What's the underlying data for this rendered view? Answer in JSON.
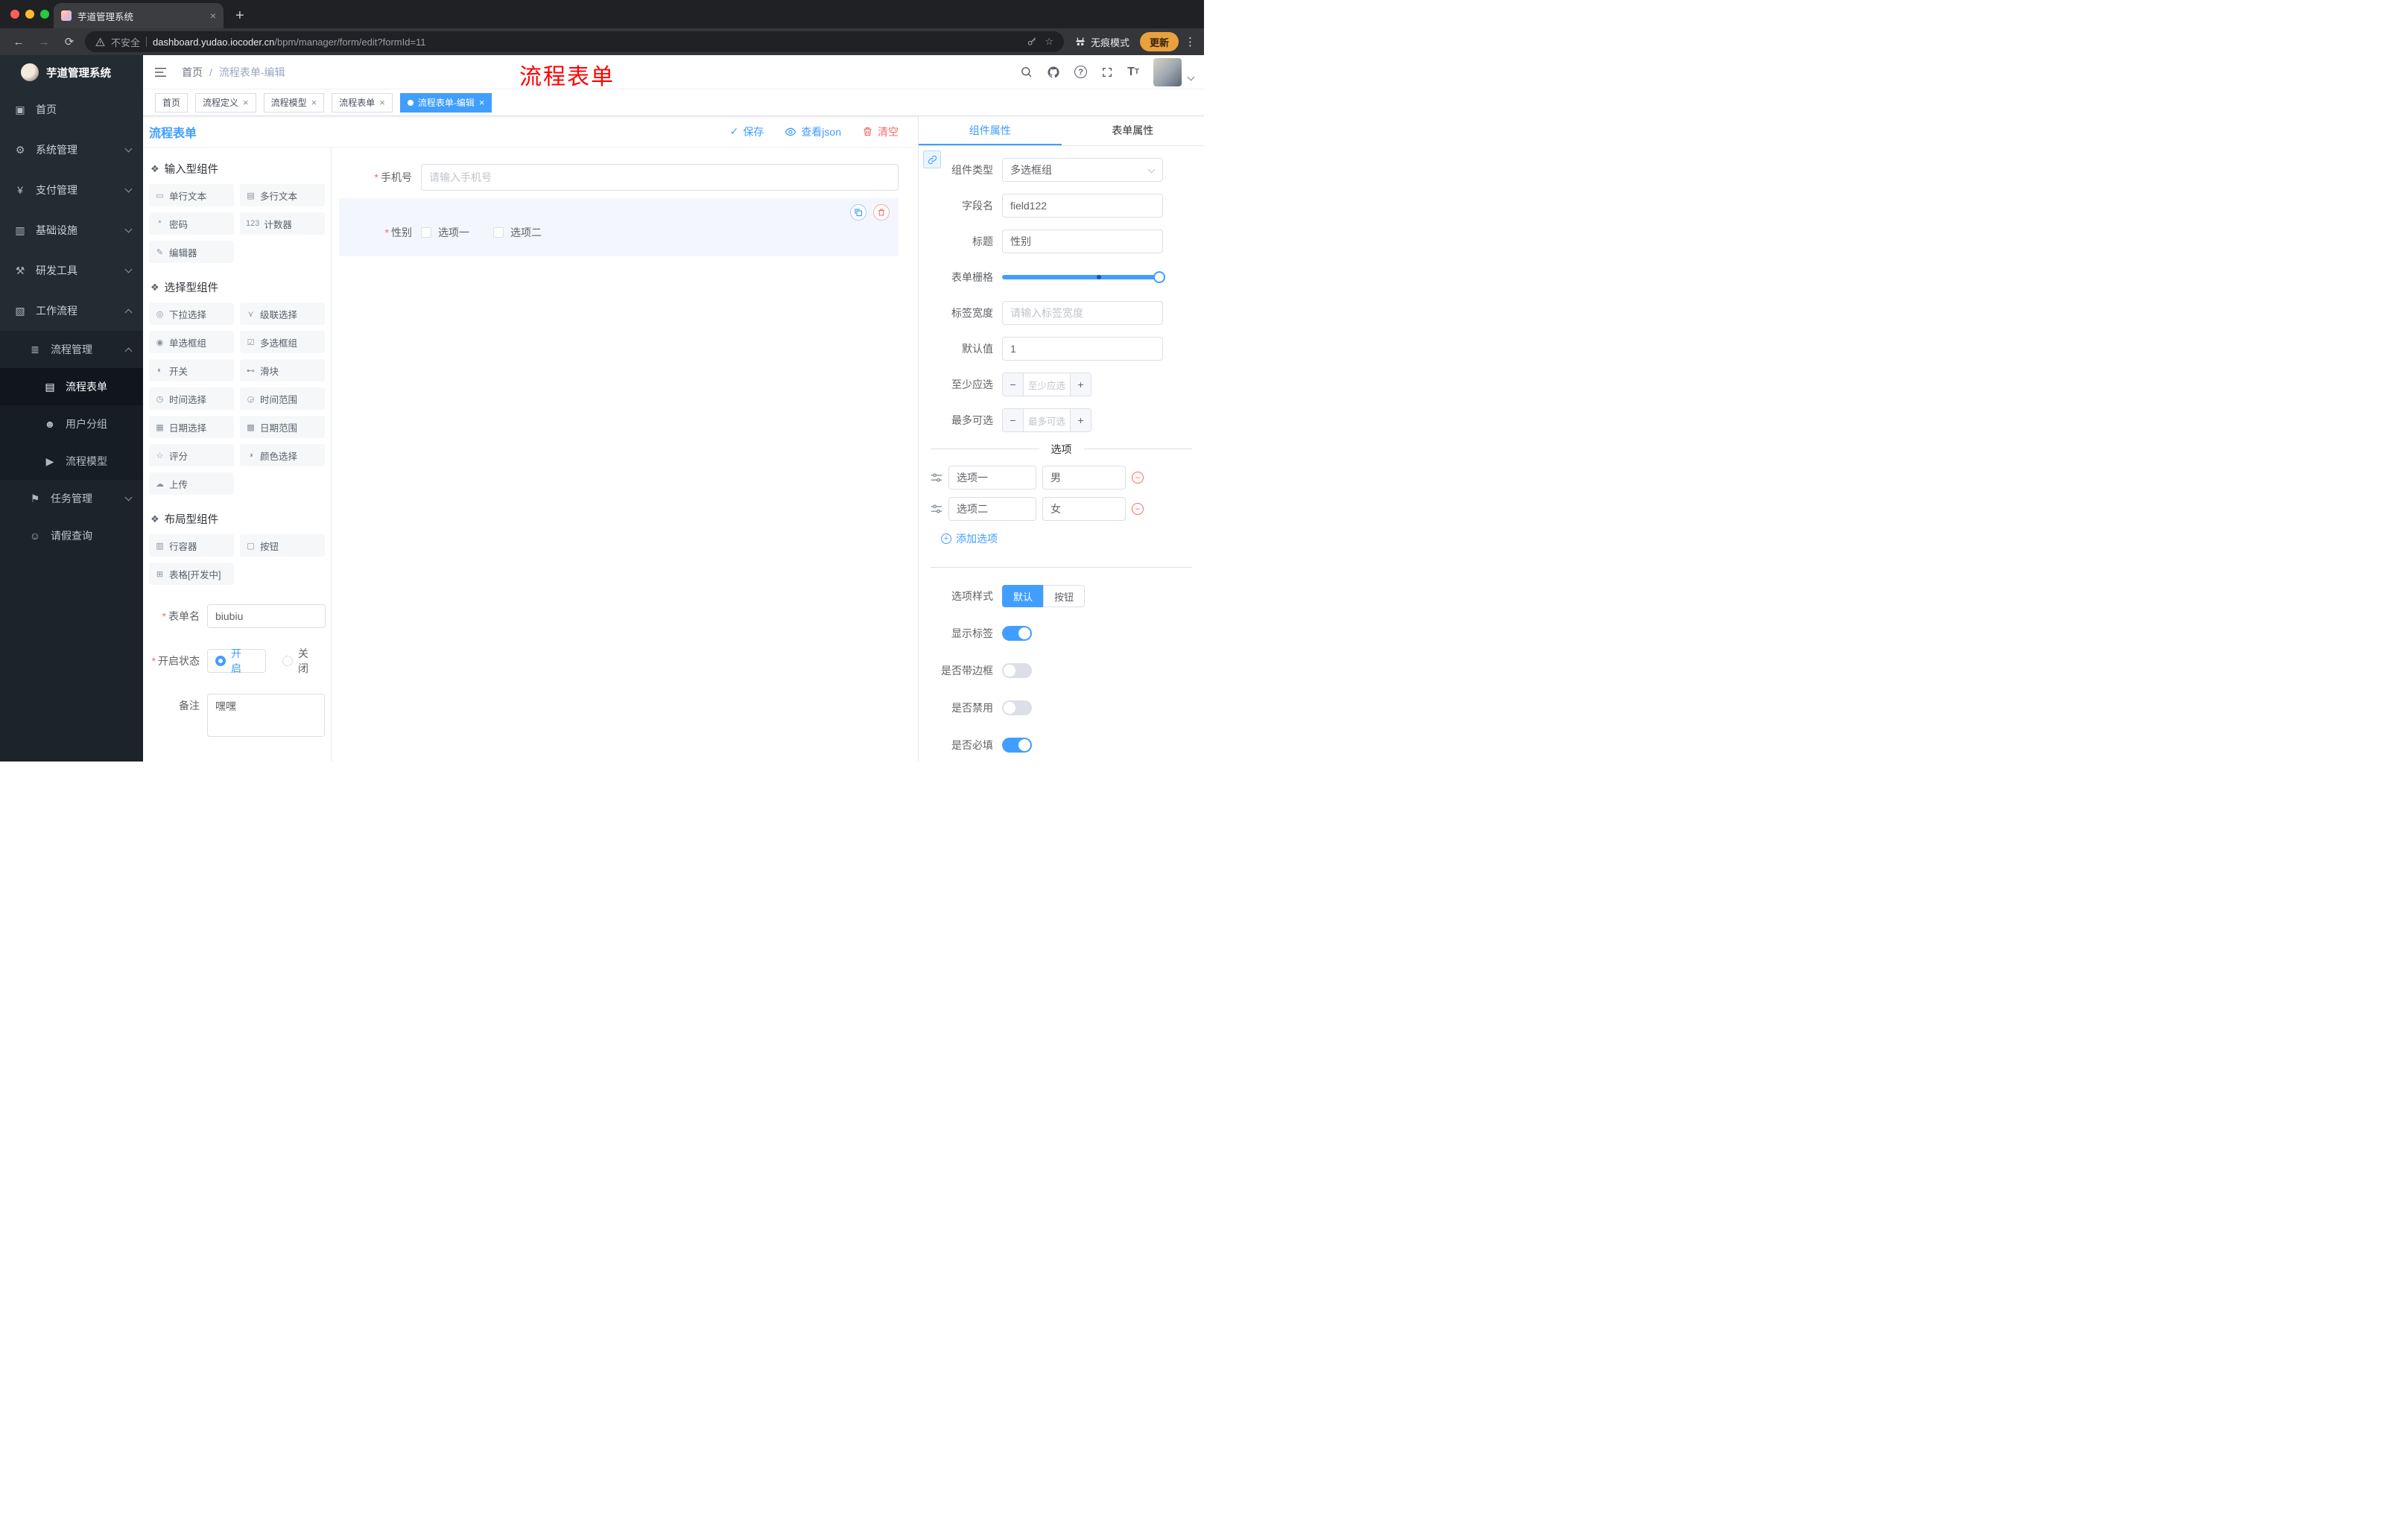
{
  "browser": {
    "tab_title": "芋道管理系统",
    "security_label": "不安全",
    "url_domain": "dashboard.yudao.iocoder.cn",
    "url_path": "/bpm/manager/form/edit?formId=11",
    "incognito_label": "无痕模式",
    "update_label": "更新"
  },
  "sidebar": {
    "logo_title": "芋道管理系统",
    "items": [
      {
        "label": "首页",
        "glyph": "▣"
      },
      {
        "label": "系统管理",
        "glyph": "⚙"
      },
      {
        "label": "支付管理",
        "glyph": "¥"
      },
      {
        "label": "基础设施",
        "glyph": "▥"
      },
      {
        "label": "研发工具",
        "glyph": "⚒"
      },
      {
        "label": "工作流程",
        "glyph": "▧"
      }
    ],
    "sub": [
      {
        "label": "流程管理",
        "glyph": "≣"
      },
      {
        "label": "流程表单",
        "glyph": "▤"
      },
      {
        "label": "用户分组",
        "glyph": "☻"
      },
      {
        "label": "流程模型",
        "glyph": "▶"
      },
      {
        "label": "任务管理",
        "glyph": "⚑"
      },
      {
        "label": "请假查询",
        "glyph": "☺"
      }
    ]
  },
  "header": {
    "breadcrumb_root": "首页",
    "breadcrumb_current": "流程表单-编辑",
    "annotation": "流程表单"
  },
  "tags": [
    {
      "label": "首页"
    },
    {
      "label": "流程定义"
    },
    {
      "label": "流程模型"
    },
    {
      "label": "流程表单"
    },
    {
      "label": "流程表单-编辑"
    }
  ],
  "toolbar": {
    "title": "流程表单",
    "save_label": "保存",
    "view_json_label": "查看json",
    "clear_label": "清空"
  },
  "palette": {
    "sections": [
      {
        "title": "输入型组件",
        "items": [
          {
            "label": "单行文本",
            "glyph": "▭"
          },
          {
            "label": "多行文本",
            "glyph": "▤"
          },
          {
            "label": "密码",
            "glyph": "*"
          },
          {
            "label": "计数器",
            "glyph": "123"
          },
          {
            "label": "编辑器",
            "glyph": "✎"
          }
        ]
      },
      {
        "title": "选择型组件",
        "items": [
          {
            "label": "下拉选择",
            "glyph": "◎"
          },
          {
            "label": "级联选择",
            "glyph": "⋎"
          },
          {
            "label": "单选框组",
            "glyph": "◉"
          },
          {
            "label": "多选框组",
            "glyph": "☑"
          },
          {
            "label": "开关",
            "glyph": "◐"
          },
          {
            "label": "滑块",
            "glyph": "⊷"
          },
          {
            "label": "时间选择",
            "glyph": "◷"
          },
          {
            "label": "时间范围",
            "glyph": "◶"
          },
          {
            "label": "日期选择",
            "glyph": "▦"
          },
          {
            "label": "日期范围",
            "glyph": "▩"
          },
          {
            "label": "评分",
            "glyph": "☆"
          },
          {
            "label": "颜色选择",
            "glyph": "◑"
          },
          {
            "label": "上传",
            "glyph": "☁"
          }
        ]
      },
      {
        "title": "布局型组件",
        "items": [
          {
            "label": "行容器",
            "glyph": "▥"
          },
          {
            "label": "按钮",
            "glyph": "▢"
          },
          {
            "label": "表格[开发中]",
            "glyph": "⊞"
          }
        ]
      }
    ]
  },
  "form_meta": {
    "name_label": "表单名",
    "name_value": "biubiu",
    "status_label": "开启状态",
    "status_on": "开启",
    "status_off": "关闭",
    "remark_label": "备注",
    "remark_value": "嘿嘿"
  },
  "canvas": {
    "phone_label": "手机号",
    "phone_placeholder": "请输入手机号",
    "gender_label": "性别",
    "gender_options": [
      "选项一",
      "选项二"
    ]
  },
  "props": {
    "tab_component": "组件属性",
    "tab_form": "表单属性",
    "type_label": "组件类型",
    "type_value": "多选框组",
    "field_label": "字段名",
    "field_value": "field122",
    "title_label": "标题",
    "title_value": "性别",
    "grid_label": "表单栅格",
    "width_label": "标签宽度",
    "width_placeholder": "请输入标签宽度",
    "default_label": "默认值",
    "default_value": "1",
    "min_label": "至少应选",
    "min_placeholder": "至少应选",
    "max_label": "最多可选",
    "max_placeholder": "最多可选",
    "options_divider": "选项",
    "options": [
      {
        "label": "选项一",
        "value": "男"
      },
      {
        "label": "选项二",
        "value": "女"
      }
    ],
    "add_option_label": "添加选项",
    "style_label": "选项样式",
    "style_default": "默认",
    "style_button": "按钮",
    "toggles": [
      {
        "label": "显示标签",
        "on": true
      },
      {
        "label": "是否带边框",
        "on": false
      },
      {
        "label": "是否禁用",
        "on": false
      },
      {
        "label": "是否必填",
        "on": true
      }
    ]
  },
  "colors": {
    "primary": "#409EFF",
    "danger": "#F56C6C",
    "annotation": "#FF0000",
    "update_pill": "#E8A13D"
  }
}
